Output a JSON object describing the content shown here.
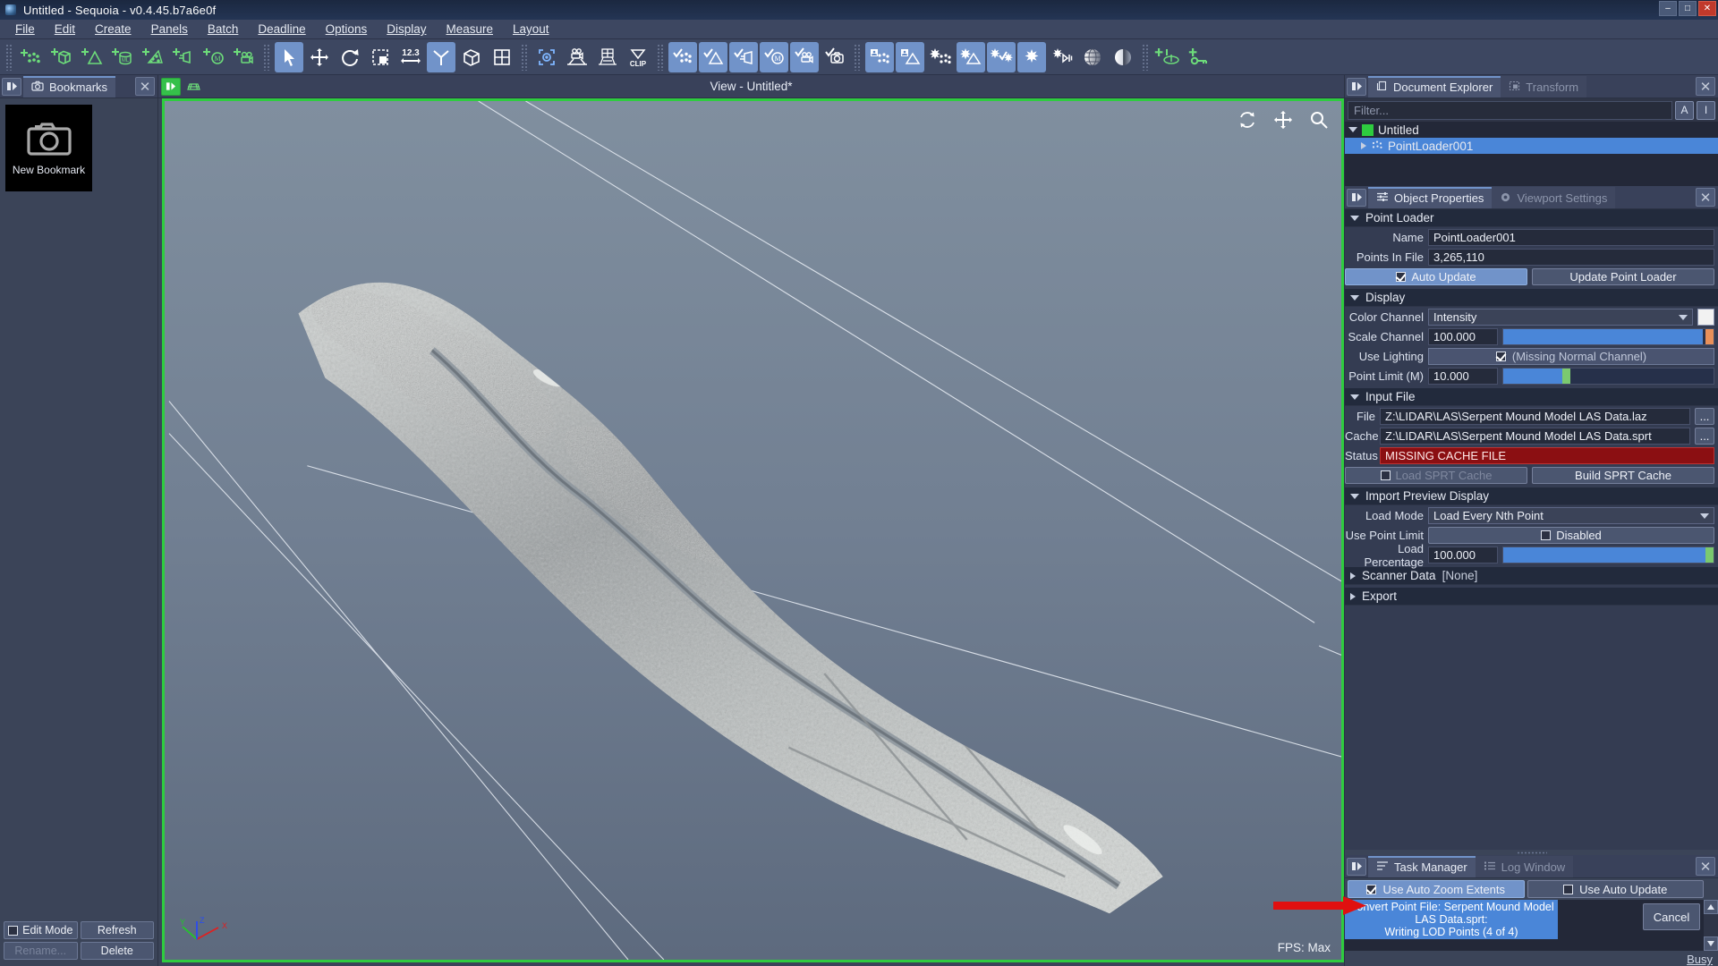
{
  "window": {
    "title": "Untitled - Sequoia - v0.4.45.b7a6e0f",
    "minimize": "–",
    "maximize": "□",
    "close": "✕",
    "app_icon": "sequoia-app-icon"
  },
  "menubar": {
    "items": [
      "File",
      "Edit",
      "Create",
      "Panels",
      "Batch",
      "Deadline",
      "Options",
      "Display",
      "Measure",
      "Layout"
    ]
  },
  "toolbar": {
    "groups": [
      {
        "name": "create",
        "buttons": [
          {
            "icon": "add-points-icon",
            "active": false
          },
          {
            "icon": "add-box-icon",
            "active": false
          },
          {
            "icon": "add-mesh-icon",
            "active": false
          },
          {
            "icon": "add-ml-database-icon",
            "active": false
          },
          {
            "icon": "add-particle-mesher-icon",
            "active": false
          },
          {
            "icon": "add-light-icon",
            "active": false
          },
          {
            "icon": "add-magma-icon",
            "active": false
          },
          {
            "icon": "add-camera-icon",
            "active": false
          }
        ]
      },
      {
        "name": "transform",
        "buttons": [
          {
            "icon": "select-arrow-icon",
            "active": true
          },
          {
            "icon": "move-icon",
            "active": false
          },
          {
            "icon": "rotate-icon",
            "active": false
          },
          {
            "icon": "scale-icon",
            "active": false
          },
          {
            "icon": "numeric-123-icon",
            "active": false
          },
          {
            "icon": "axis-tripod-icon",
            "active": true
          },
          {
            "icon": "box-gizmo-icon",
            "active": false
          },
          {
            "icon": "grid-icon",
            "active": false
          }
        ]
      },
      {
        "name": "view",
        "buttons": [
          {
            "icon": "zoom-extents-icon",
            "active": false
          },
          {
            "icon": "camera-viewport-icon",
            "active": false
          },
          {
            "icon": "perspective-grid-icon",
            "active": false
          },
          {
            "icon": "clip-icon",
            "active": false,
            "label": "CLIP"
          }
        ]
      },
      {
        "name": "visibility",
        "buttons": [
          {
            "icon": "show-points-icon",
            "active": true
          },
          {
            "icon": "show-mesh-icon",
            "active": true
          },
          {
            "icon": "show-light-icon",
            "active": true
          },
          {
            "icon": "show-magma-icon",
            "active": true
          },
          {
            "icon": "show-camera-icon",
            "active": true
          },
          {
            "icon": "show-bookmark-icon",
            "active": false
          }
        ]
      },
      {
        "name": "markers",
        "buttons": [
          {
            "icon": "marker-points-icon",
            "active": true
          },
          {
            "icon": "marker-mesh-icon",
            "active": true
          },
          {
            "icon": "star-points-icon",
            "active": false
          },
          {
            "icon": "star-mesh-icon",
            "active": true
          },
          {
            "icon": "star-check-icon",
            "active": true
          },
          {
            "icon": "star-highlight-icon",
            "active": true
          }
        ]
      },
      {
        "name": "shading",
        "buttons": [
          {
            "icon": "headlight-icon",
            "active": false
          },
          {
            "icon": "globe-shading-icon",
            "active": false
          },
          {
            "icon": "sphere-shading-icon",
            "active": false
          }
        ]
      },
      {
        "name": "extras",
        "buttons": [
          {
            "icon": "add-marker-icon",
            "active": false
          },
          {
            "icon": "add-key-icon",
            "active": false
          }
        ]
      }
    ]
  },
  "bookmarks_panel": {
    "tab_label": "Bookmarks",
    "tab_icon": "camera-icon",
    "tile_label": "New Bookmark",
    "tile_icon": "camera-large-icon",
    "buttons": {
      "edit_mode": "Edit Mode",
      "edit_mode_checked": false,
      "refresh": "Refresh",
      "rename": "Rename...",
      "delete": "Delete"
    }
  },
  "viewport": {
    "title": "View - Untitled*",
    "tools": [
      "refresh-rotate-icon",
      "pan-move-icon",
      "zoom-magnifier-icon"
    ],
    "fps_label": "FPS:  Max",
    "axis": {
      "x": "X",
      "y": "Y",
      "z": "Z"
    },
    "content": "lidar-point-cloud-serpent-mound"
  },
  "document_explorer": {
    "tabs": [
      {
        "label": "Document Explorer",
        "icon": "documents-icon",
        "active": true
      },
      {
        "label": "Transform",
        "icon": "transform-icon",
        "active": false
      }
    ],
    "filter_placeholder": "Filter...",
    "filter_value": "",
    "side_buttons": [
      "A",
      "I"
    ],
    "tree": [
      {
        "label": "Untitled",
        "depth": 0,
        "expanded": true,
        "selected": false,
        "swatch": "#2ecc3f"
      },
      {
        "label": "PointLoader001",
        "depth": 1,
        "expanded": false,
        "selected": true,
        "icon": "points-icon"
      }
    ]
  },
  "object_properties": {
    "tabs": [
      {
        "label": "Object Properties",
        "icon": "sliders-icon",
        "active": true
      },
      {
        "label": "Viewport Settings",
        "icon": "gear-icon",
        "active": false
      }
    ],
    "sections": {
      "point_loader": {
        "title": "Point Loader",
        "expanded": true,
        "name_label": "Name",
        "name_value": "PointLoader001",
        "points_label": "Points In File",
        "points_value": "3,265,110",
        "auto_update_label": "Auto Update",
        "auto_update_checked": true,
        "update_button": "Update Point Loader"
      },
      "display": {
        "title": "Display",
        "expanded": true,
        "color_channel_label": "Color Channel",
        "color_channel_value": "Intensity",
        "color_swatch": "#f2f2f2",
        "scale_channel_label": "Scale Channel",
        "scale_channel_value": "100.000",
        "scale_channel_pct": 96,
        "use_lighting_label": "Use Lighting",
        "use_lighting_checked": true,
        "use_lighting_note": "(Missing Normal Channel)",
        "point_limit_label": "Point Limit (M)",
        "point_limit_value": "10.000",
        "point_limit_pct": 31
      },
      "input_file": {
        "title": "Input File",
        "expanded": true,
        "file_label": "File",
        "file_value": "Z:\\LIDAR\\LAS\\Serpent Mound Model LAS Data.laz",
        "cache_label": "Cache",
        "cache_value": "Z:\\LIDAR\\LAS\\Serpent Mound Model LAS Data.sprt",
        "browse_label": "...",
        "status_label": "Status",
        "status_value": "MISSING CACHE FILE",
        "status_color": "#8b0f12",
        "load_cache_label": "Load SPRT Cache",
        "load_cache_checked": false,
        "load_cache_enabled": false,
        "build_cache_label": "Build SPRT Cache"
      },
      "import_preview": {
        "title": "Import Preview Display",
        "expanded": true,
        "load_mode_label": "Load Mode",
        "load_mode_value": "Load Every Nth Point",
        "use_point_limit_label": "Use Point Limit",
        "use_point_limit_value": "Disabled",
        "use_point_limit_checked": false,
        "load_percentage_label": "Load Percentage",
        "load_percentage_value": "100.000",
        "load_percentage_pct": 97
      },
      "scanner_data": {
        "title": "Scanner Data",
        "value": "[None]",
        "expanded": false
      },
      "export": {
        "title": "Export",
        "expanded": false
      }
    }
  },
  "task_manager": {
    "tabs": [
      {
        "label": "Task Manager",
        "icon": "task-list-icon",
        "active": true
      },
      {
        "label": "Log Window",
        "icon": "log-icon",
        "active": false
      }
    ],
    "auto_zoom_label": "Use Auto Zoom Extents",
    "auto_zoom_checked": true,
    "auto_update_label": "Use Auto Update",
    "auto_update_checked": false,
    "task": {
      "line1": "Convert Point File: Serpent Mound Model LAS Data.sprt:",
      "line2": "Writing LOD Points (4 of 4)",
      "cancel_label": "Cancel"
    },
    "status": "Busy"
  }
}
